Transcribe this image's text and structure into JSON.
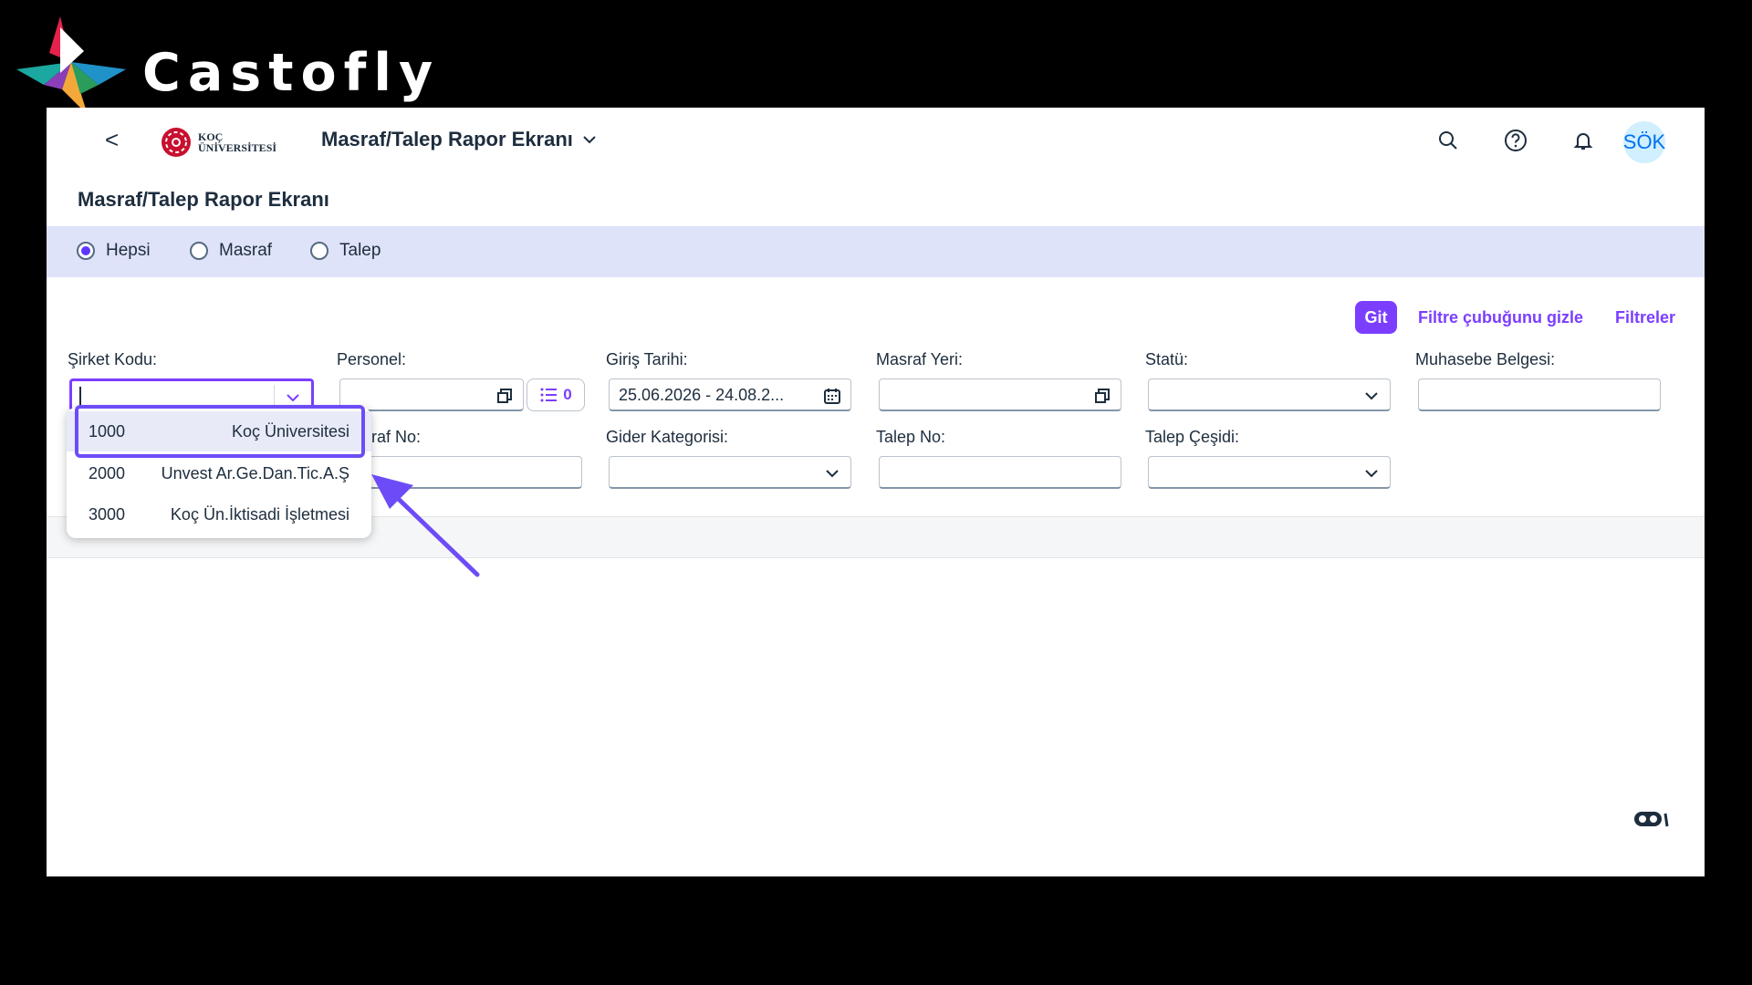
{
  "overlay": {
    "brand_text": "Castofly"
  },
  "shell": {
    "back_label": "<",
    "logo_line1": "KOÇ",
    "logo_line2": "ÜNİVERSİTESİ",
    "app_title": "Masraf/Talep Rapor Ekranı",
    "avatar_initials": "SÖK",
    "icons": [
      "search-icon",
      "help-icon",
      "bell-icon"
    ]
  },
  "page": {
    "title": "Masraf/Talep Rapor Ekranı"
  },
  "radio_group": {
    "options": [
      {
        "label": "Hepsi",
        "selected": true
      },
      {
        "label": "Masraf",
        "selected": false
      },
      {
        "label": "Talep",
        "selected": false
      }
    ]
  },
  "filter_bar": {
    "go_label": "Git",
    "hide_label": "Filtre çubuğunu gizle",
    "filters_label": "Filtreler"
  },
  "fields": {
    "sirket_kodu": {
      "label": "Şirket Kodu:",
      "value": ""
    },
    "personel": {
      "label": "Personel:",
      "value": "",
      "token_count": "0"
    },
    "giris_tarihi": {
      "label": "Giriş Tarihi:",
      "value": "25.06.2026 - 24.08.2..."
    },
    "masraf_yeri": {
      "label": "Masraf Yeri:",
      "value": ""
    },
    "statu": {
      "label": "Statü:",
      "value": ""
    },
    "muhasebe_belgesi": {
      "label": "Muhasebe Belgesi:",
      "value": ""
    },
    "masraf_no": {
      "label": "raf No:",
      "value": ""
    },
    "gider_kategorisi": {
      "label": "Gider Kategorisi:",
      "value": ""
    },
    "talep_no": {
      "label": "Talep No:",
      "value": ""
    },
    "talep_cesidi": {
      "label": "Talep Çeşidi:",
      "value": ""
    }
  },
  "dropdown": {
    "options": [
      {
        "code": "1000",
        "name": "Koç Üniversitesi",
        "selected": true
      },
      {
        "code": "2000",
        "name": "Unvest Ar.Ge.Dan.Tic.A.Ş",
        "selected": false
      },
      {
        "code": "3000",
        "name": "Koç Ün.İktisadi İşletmesi",
        "selected": false
      }
    ]
  },
  "colors": {
    "accent": "#7b3eff",
    "radio_bar": "#dfe3fa",
    "highlight": "#6d4cf7",
    "avatar_bg": "#d1efff"
  }
}
